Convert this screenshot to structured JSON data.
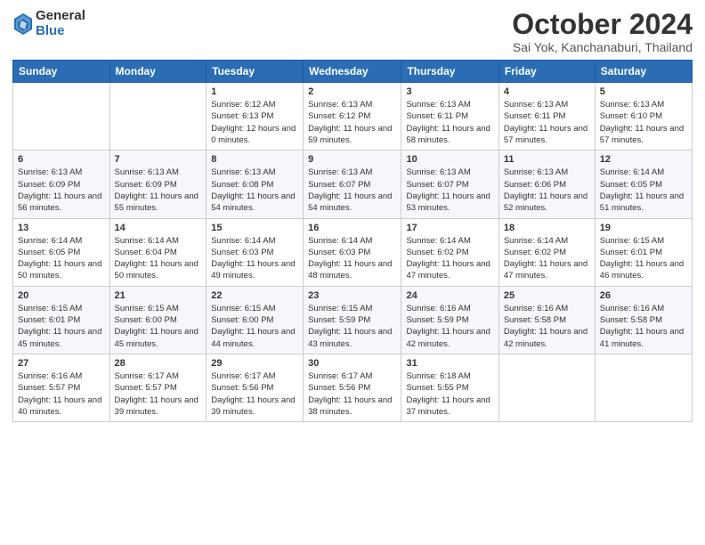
{
  "header": {
    "logo_general": "General",
    "logo_blue": "Blue",
    "month_title": "October 2024",
    "location": "Sai Yok, Kanchanaburi, Thailand"
  },
  "weekdays": [
    "Sunday",
    "Monday",
    "Tuesday",
    "Wednesday",
    "Thursday",
    "Friday",
    "Saturday"
  ],
  "weeks": [
    [
      {
        "day": "",
        "sunrise": "",
        "sunset": "",
        "daylight": ""
      },
      {
        "day": "",
        "sunrise": "",
        "sunset": "",
        "daylight": ""
      },
      {
        "day": "1",
        "sunrise": "Sunrise: 6:12 AM",
        "sunset": "Sunset: 6:13 PM",
        "daylight": "Daylight: 12 hours and 0 minutes."
      },
      {
        "day": "2",
        "sunrise": "Sunrise: 6:13 AM",
        "sunset": "Sunset: 6:12 PM",
        "daylight": "Daylight: 11 hours and 59 minutes."
      },
      {
        "day": "3",
        "sunrise": "Sunrise: 6:13 AM",
        "sunset": "Sunset: 6:11 PM",
        "daylight": "Daylight: 11 hours and 58 minutes."
      },
      {
        "day": "4",
        "sunrise": "Sunrise: 6:13 AM",
        "sunset": "Sunset: 6:11 PM",
        "daylight": "Daylight: 11 hours and 57 minutes."
      },
      {
        "day": "5",
        "sunrise": "Sunrise: 6:13 AM",
        "sunset": "Sunset: 6:10 PM",
        "daylight": "Daylight: 11 hours and 57 minutes."
      }
    ],
    [
      {
        "day": "6",
        "sunrise": "Sunrise: 6:13 AM",
        "sunset": "Sunset: 6:09 PM",
        "daylight": "Daylight: 11 hours and 56 minutes."
      },
      {
        "day": "7",
        "sunrise": "Sunrise: 6:13 AM",
        "sunset": "Sunset: 6:09 PM",
        "daylight": "Daylight: 11 hours and 55 minutes."
      },
      {
        "day": "8",
        "sunrise": "Sunrise: 6:13 AM",
        "sunset": "Sunset: 6:08 PM",
        "daylight": "Daylight: 11 hours and 54 minutes."
      },
      {
        "day": "9",
        "sunrise": "Sunrise: 6:13 AM",
        "sunset": "Sunset: 6:07 PM",
        "daylight": "Daylight: 11 hours and 54 minutes."
      },
      {
        "day": "10",
        "sunrise": "Sunrise: 6:13 AM",
        "sunset": "Sunset: 6:07 PM",
        "daylight": "Daylight: 11 hours and 53 minutes."
      },
      {
        "day": "11",
        "sunrise": "Sunrise: 6:13 AM",
        "sunset": "Sunset: 6:06 PM",
        "daylight": "Daylight: 11 hours and 52 minutes."
      },
      {
        "day": "12",
        "sunrise": "Sunrise: 6:14 AM",
        "sunset": "Sunset: 6:05 PM",
        "daylight": "Daylight: 11 hours and 51 minutes."
      }
    ],
    [
      {
        "day": "13",
        "sunrise": "Sunrise: 6:14 AM",
        "sunset": "Sunset: 6:05 PM",
        "daylight": "Daylight: 11 hours and 50 minutes."
      },
      {
        "day": "14",
        "sunrise": "Sunrise: 6:14 AM",
        "sunset": "Sunset: 6:04 PM",
        "daylight": "Daylight: 11 hours and 50 minutes."
      },
      {
        "day": "15",
        "sunrise": "Sunrise: 6:14 AM",
        "sunset": "Sunset: 6:03 PM",
        "daylight": "Daylight: 11 hours and 49 minutes."
      },
      {
        "day": "16",
        "sunrise": "Sunrise: 6:14 AM",
        "sunset": "Sunset: 6:03 PM",
        "daylight": "Daylight: 11 hours and 48 minutes."
      },
      {
        "day": "17",
        "sunrise": "Sunrise: 6:14 AM",
        "sunset": "Sunset: 6:02 PM",
        "daylight": "Daylight: 11 hours and 47 minutes."
      },
      {
        "day": "18",
        "sunrise": "Sunrise: 6:14 AM",
        "sunset": "Sunset: 6:02 PM",
        "daylight": "Daylight: 11 hours and 47 minutes."
      },
      {
        "day": "19",
        "sunrise": "Sunrise: 6:15 AM",
        "sunset": "Sunset: 6:01 PM",
        "daylight": "Daylight: 11 hours and 46 minutes."
      }
    ],
    [
      {
        "day": "20",
        "sunrise": "Sunrise: 6:15 AM",
        "sunset": "Sunset: 6:01 PM",
        "daylight": "Daylight: 11 hours and 45 minutes."
      },
      {
        "day": "21",
        "sunrise": "Sunrise: 6:15 AM",
        "sunset": "Sunset: 6:00 PM",
        "daylight": "Daylight: 11 hours and 45 minutes."
      },
      {
        "day": "22",
        "sunrise": "Sunrise: 6:15 AM",
        "sunset": "Sunset: 6:00 PM",
        "daylight": "Daylight: 11 hours and 44 minutes."
      },
      {
        "day": "23",
        "sunrise": "Sunrise: 6:15 AM",
        "sunset": "Sunset: 5:59 PM",
        "daylight": "Daylight: 11 hours and 43 minutes."
      },
      {
        "day": "24",
        "sunrise": "Sunrise: 6:16 AM",
        "sunset": "Sunset: 5:59 PM",
        "daylight": "Daylight: 11 hours and 42 minutes."
      },
      {
        "day": "25",
        "sunrise": "Sunrise: 6:16 AM",
        "sunset": "Sunset: 5:58 PM",
        "daylight": "Daylight: 11 hours and 42 minutes."
      },
      {
        "day": "26",
        "sunrise": "Sunrise: 6:16 AM",
        "sunset": "Sunset: 5:58 PM",
        "daylight": "Daylight: 11 hours and 41 minutes."
      }
    ],
    [
      {
        "day": "27",
        "sunrise": "Sunrise: 6:16 AM",
        "sunset": "Sunset: 5:57 PM",
        "daylight": "Daylight: 11 hours and 40 minutes."
      },
      {
        "day": "28",
        "sunrise": "Sunrise: 6:17 AM",
        "sunset": "Sunset: 5:57 PM",
        "daylight": "Daylight: 11 hours and 39 minutes."
      },
      {
        "day": "29",
        "sunrise": "Sunrise: 6:17 AM",
        "sunset": "Sunset: 5:56 PM",
        "daylight": "Daylight: 11 hours and 39 minutes."
      },
      {
        "day": "30",
        "sunrise": "Sunrise: 6:17 AM",
        "sunset": "Sunset: 5:56 PM",
        "daylight": "Daylight: 11 hours and 38 minutes."
      },
      {
        "day": "31",
        "sunrise": "Sunrise: 6:18 AM",
        "sunset": "Sunset: 5:55 PM",
        "daylight": "Daylight: 11 hours and 37 minutes."
      },
      {
        "day": "",
        "sunrise": "",
        "sunset": "",
        "daylight": ""
      },
      {
        "day": "",
        "sunrise": "",
        "sunset": "",
        "daylight": ""
      }
    ]
  ]
}
